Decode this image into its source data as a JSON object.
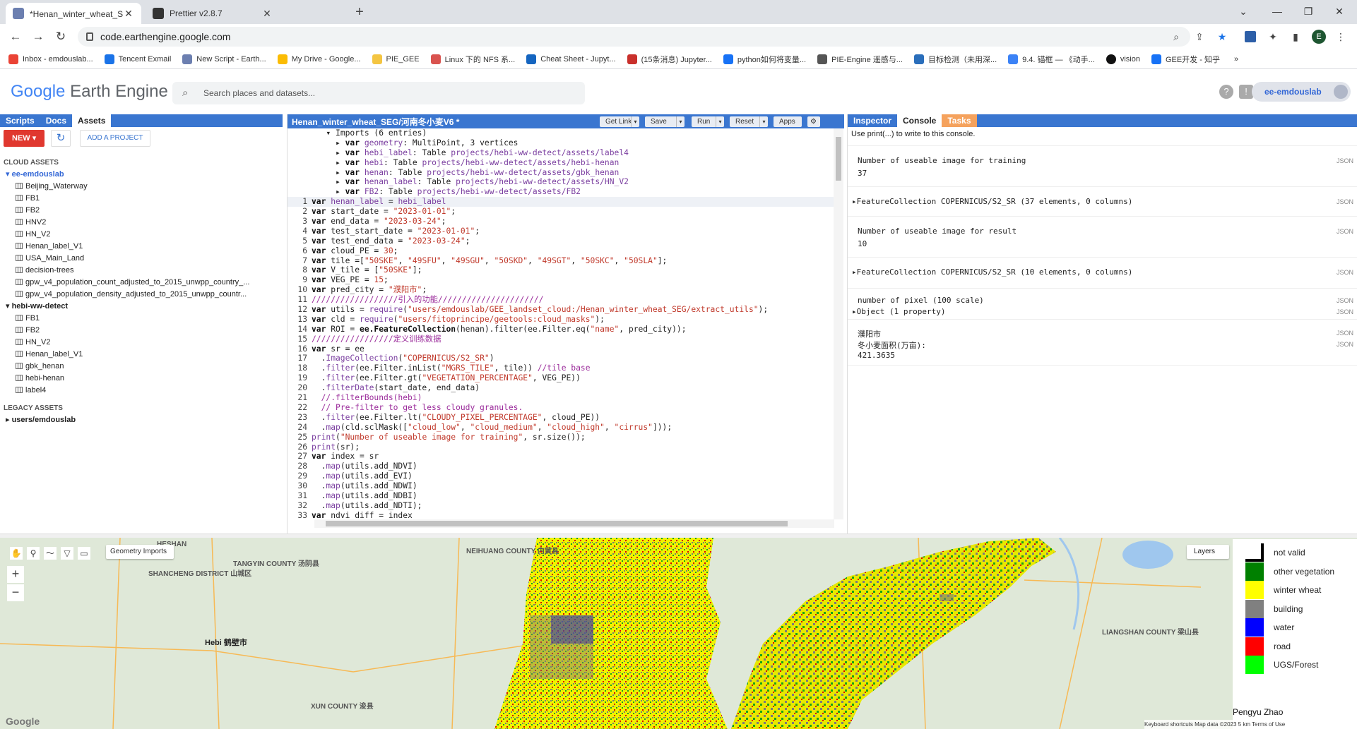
{
  "browser": {
    "tabs": [
      {
        "title": "*Henan_winter_wheat_SEG/河南冬...",
        "active": true
      },
      {
        "title": "Prettier v2.8.7",
        "active": false
      }
    ],
    "url": "code.earthengine.google.com",
    "avatar_letter": "E",
    "bookmarks": [
      "Inbox - emdouslab...",
      "Tencent Exmail",
      "New Script - Earth...",
      "My Drive - Google...",
      "PIE_GEE",
      "Linux 下的 NFS 系...",
      "Cheat Sheet - Jupyt...",
      "(15条消息) Jupyter...",
      "python如何将变量...",
      "PIE-Engine 遥感与...",
      "目标检测（未用深...",
      "9.4. 锚框 — 《动手...",
      "vision",
      "GEE开发 - 知乎"
    ],
    "more_bookmarks": "»"
  },
  "header": {
    "logo_google": "Google",
    "logo_product": "Earth Engine",
    "search_placeholder": "Search places and datasets...",
    "user": "ee-emdouslab"
  },
  "left_panel": {
    "tabs": [
      "Scripts",
      "Docs",
      "Assets"
    ],
    "active_tab": "Assets",
    "new_label": "NEW ▾",
    "add_project_label": "ADD A PROJECT",
    "cloud_assets_label": "CLOUD ASSETS",
    "root1": "ee-emdouslab",
    "root1_items": [
      "Beijing_Waterway",
      "FB1",
      "FB2",
      "HNV2",
      "HN_V2",
      "Henan_label_V1",
      "USA_Main_Land",
      "decision-trees",
      "gpw_v4_population_count_adjusted_to_2015_unwpp_country_...",
      "gpw_v4_population_density_adjusted_to_2015_unwpp_countr..."
    ],
    "root2": "hebi-ww-detect",
    "root2_items": [
      "FB1",
      "FB2",
      "HN_V2",
      "Henan_label_V1",
      "gbk_henan",
      "hebi-henan",
      "label4"
    ],
    "legacy_assets_label": "LEGACY ASSETS",
    "legacy_root": "users/emdouslab"
  },
  "editor": {
    "title": "Henan_winter_wheat_SEG/河南冬小麦V6 *",
    "buttons": [
      "Get Link",
      "Save",
      "Run",
      "Reset",
      "Apps"
    ],
    "imports_header": "Imports (6 entries)",
    "imports": [
      {
        "name": "geometry",
        "desc": "MultiPoint, 3 vertices",
        "path": ""
      },
      {
        "name": "hebi_label",
        "desc": "Table",
        "path": "projects/hebi-ww-detect/assets/label4"
      },
      {
        "name": "hebi",
        "desc": "Table",
        "path": "projects/hebi-ww-detect/assets/hebi-henan"
      },
      {
        "name": "henan",
        "desc": "Table",
        "path": "projects/hebi-ww-detect/assets/gbk_henan"
      },
      {
        "name": "henan_label",
        "desc": "Table",
        "path": "projects/hebi-ww-detect/assets/HN_V2"
      },
      {
        "name": "FB2",
        "desc": "Table",
        "path": "projects/hebi-ww-detect/assets/FB2"
      }
    ]
  },
  "console": {
    "tabs": [
      "Inspector",
      "Console",
      "Tasks"
    ],
    "active_tab": "Console",
    "hint": "Use print(...) to write to this console.",
    "json_label": "JSON",
    "entries": [
      {
        "line1": "Number of useable image for training",
        "line2": "37"
      },
      {
        "line1": "▸FeatureCollection COPERNICUS/S2_SR (37 elements, 0 columns)",
        "line2": ""
      },
      {
        "line1": "Number of useable image for result",
        "line2": "10"
      },
      {
        "line1": "▸FeatureCollection COPERNICUS/S2_SR (10 elements, 0 columns)",
        "line2": ""
      },
      {
        "line1": "number of pixel (100 scale)",
        "line2": "▸Object (1 property)"
      },
      {
        "line1": "濮阳市",
        "line2": "冬小麦面积(万亩):",
        "line3": "421.3635"
      }
    ]
  },
  "map": {
    "geometry_imports": "Geometry Imports",
    "layers": "Layers",
    "legend": [
      {
        "label": "not valid",
        "color": "#ffffff"
      },
      {
        "label": "other vegetation",
        "color": "#008000"
      },
      {
        "label": "winter wheat",
        "color": "#ffff00"
      },
      {
        "label": "building",
        "color": "#808080"
      },
      {
        "label": "water",
        "color": "#0000ff"
      },
      {
        "label": "road",
        "color": "#ff0000"
      },
      {
        "label": "UGS/Forest",
        "color": "#00ff00"
      }
    ],
    "credit": "Pengyu  Zhao",
    "footer": "Keyboard shortcuts   Map data ©2023   5 km   Terms of Use",
    "google": "Google",
    "places": [
      "HESHAN",
      "TANGYIN COUNTY 汤阴县",
      "SHANCHENG DISTRICT 山城区",
      "Hebi 鹤壁市",
      "XUN COUNTY 浚县",
      "NEIHUANG COUNTY 内黄县",
      "LIANGSHAN COUNTY 梁山县"
    ]
  }
}
